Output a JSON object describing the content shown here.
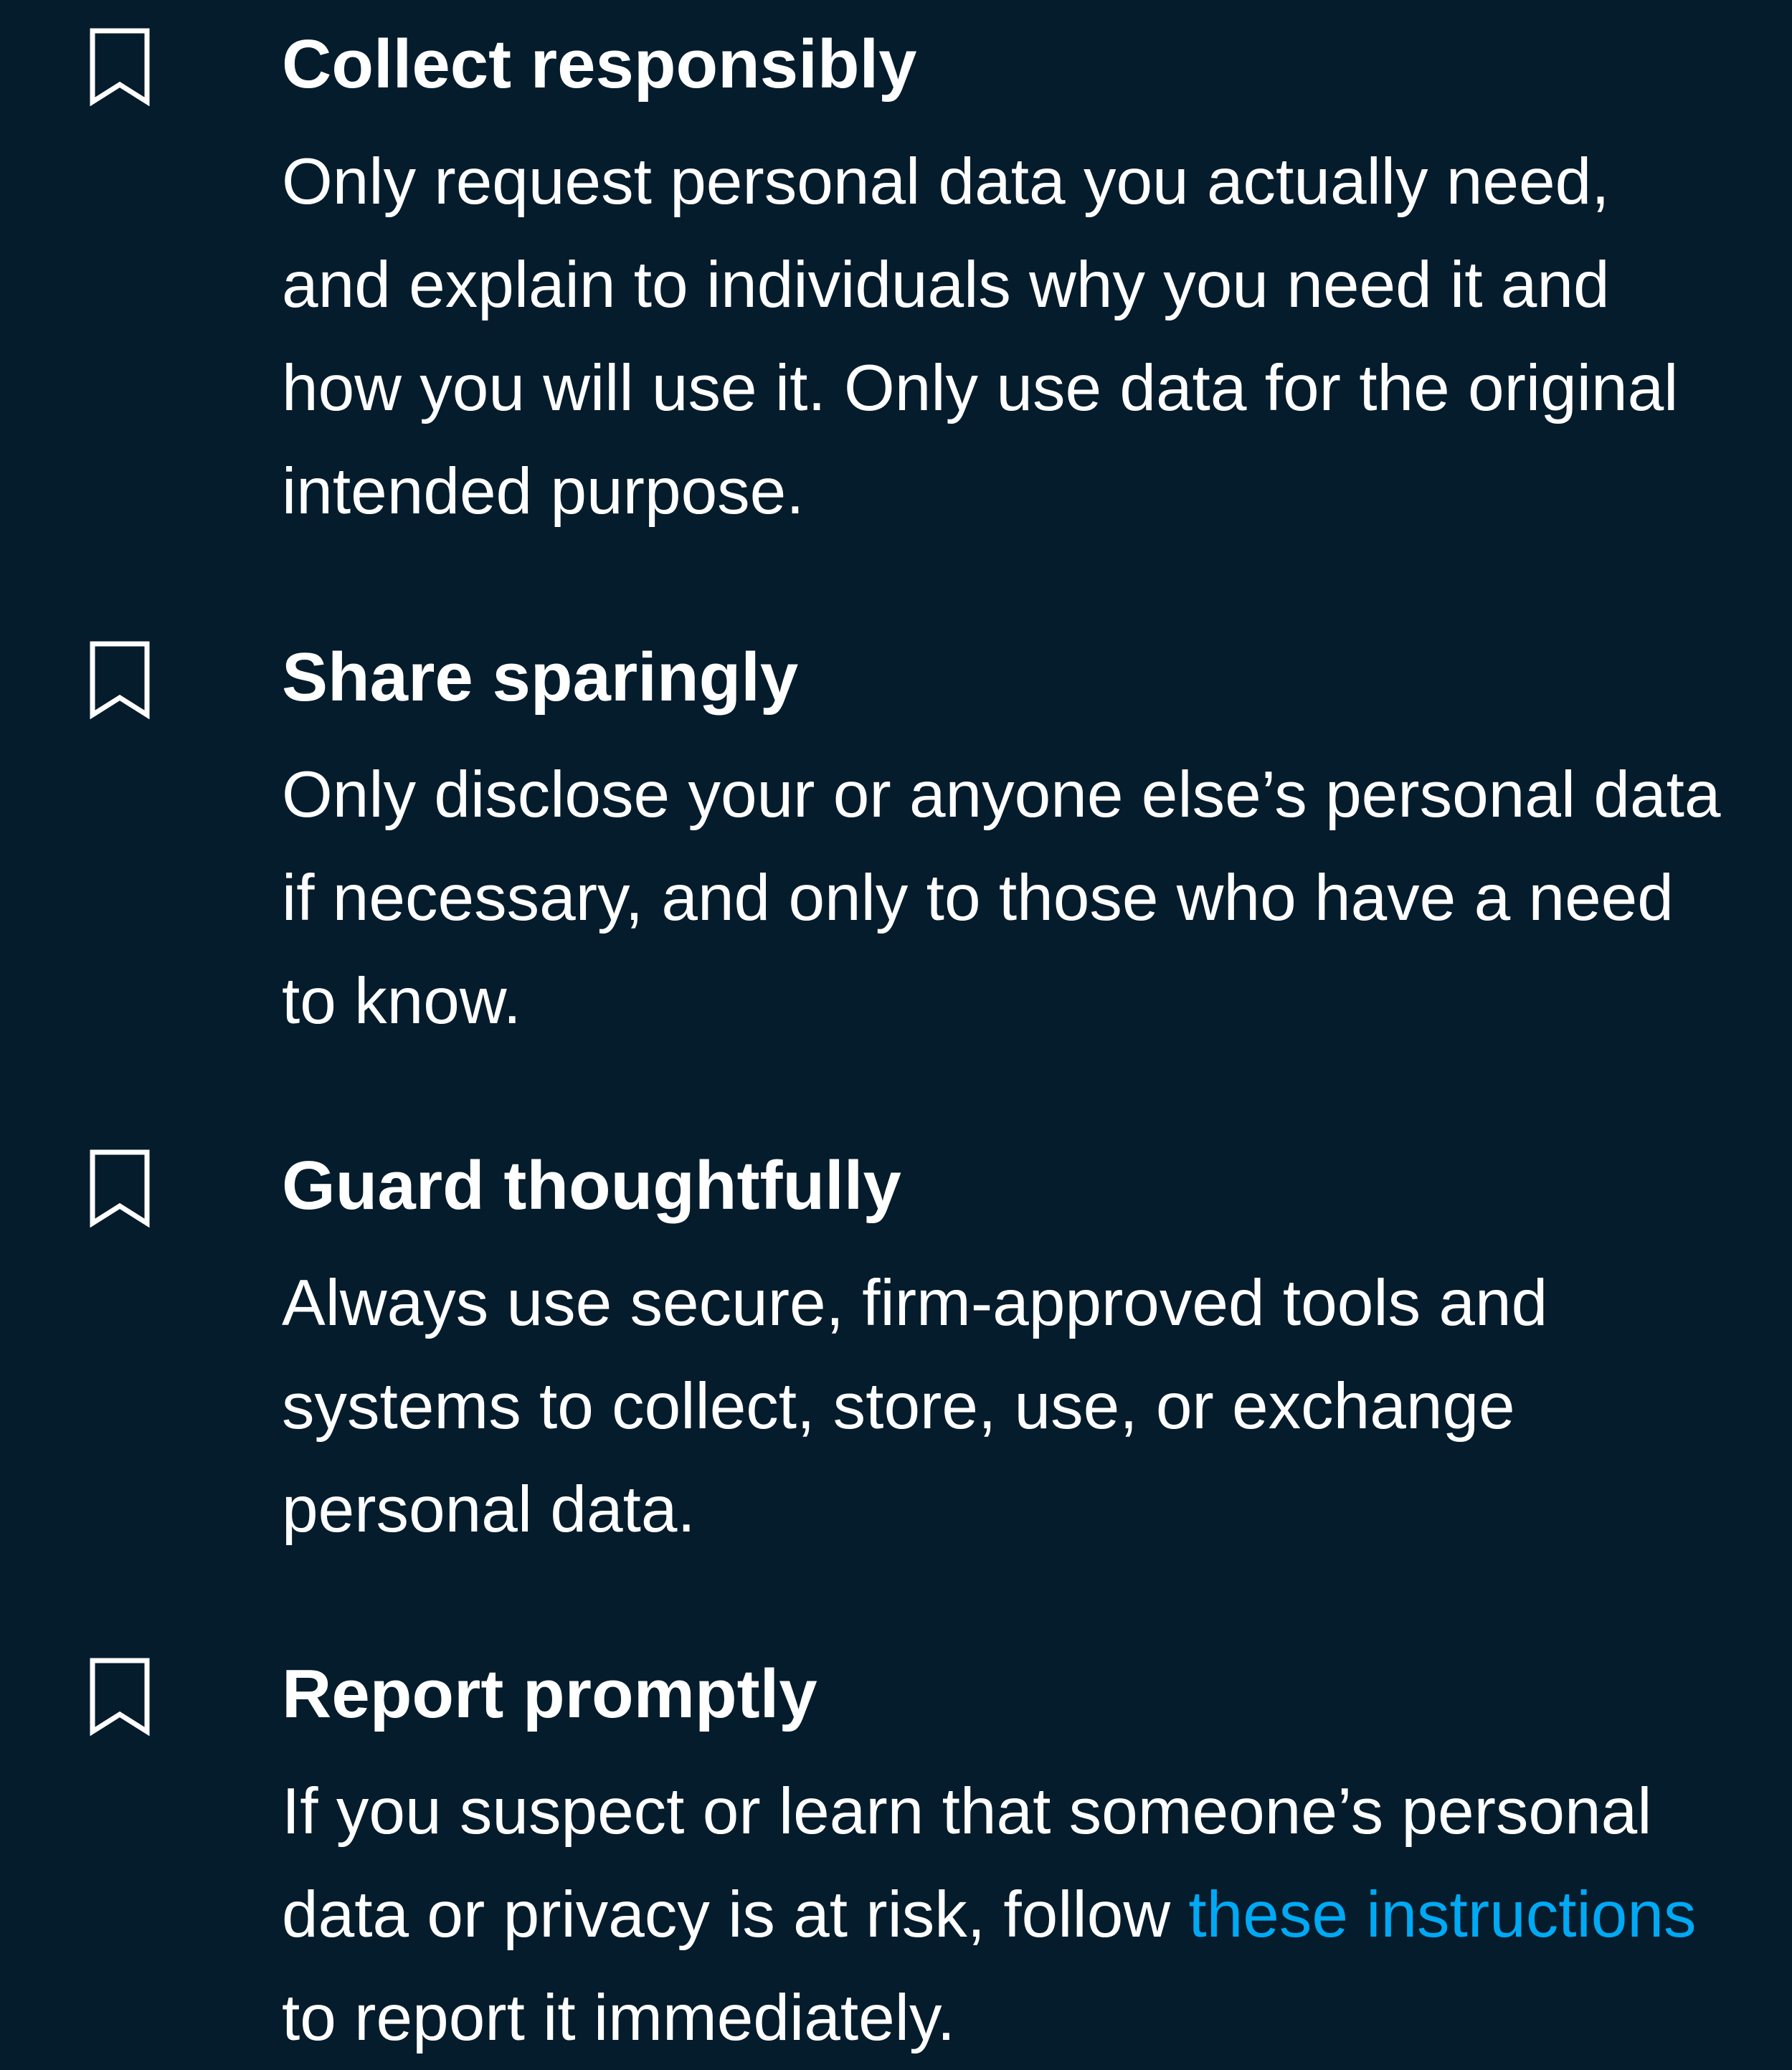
{
  "colors": {
    "background": "#051c2c",
    "text": "#ffffff",
    "link": "#00a9f4"
  },
  "items": [
    {
      "icon": "bookmark-icon",
      "title": "Collect responsibly",
      "body": "Only request personal data you actually need, and explain to individuals why you need it and how you will use it. Only use data for the original intended purpose."
    },
    {
      "icon": "bookmark-icon",
      "title": "Share sparingly",
      "body": "Only disclose your or anyone else’s personal data if necessary, and only to those who have a need to know."
    },
    {
      "icon": "bookmark-icon",
      "title": "Guard thoughtfully",
      "body": "Always use secure, firm-approved tools and systems to collect, store, use, or exchange personal data."
    },
    {
      "icon": "bookmark-icon",
      "title": "Report promptly",
      "body_before": "If you suspect or learn that someone’s personal data or privacy is at risk, follow ",
      "link_text": "these instructions",
      "body_after": " to report it immediately."
    }
  ]
}
